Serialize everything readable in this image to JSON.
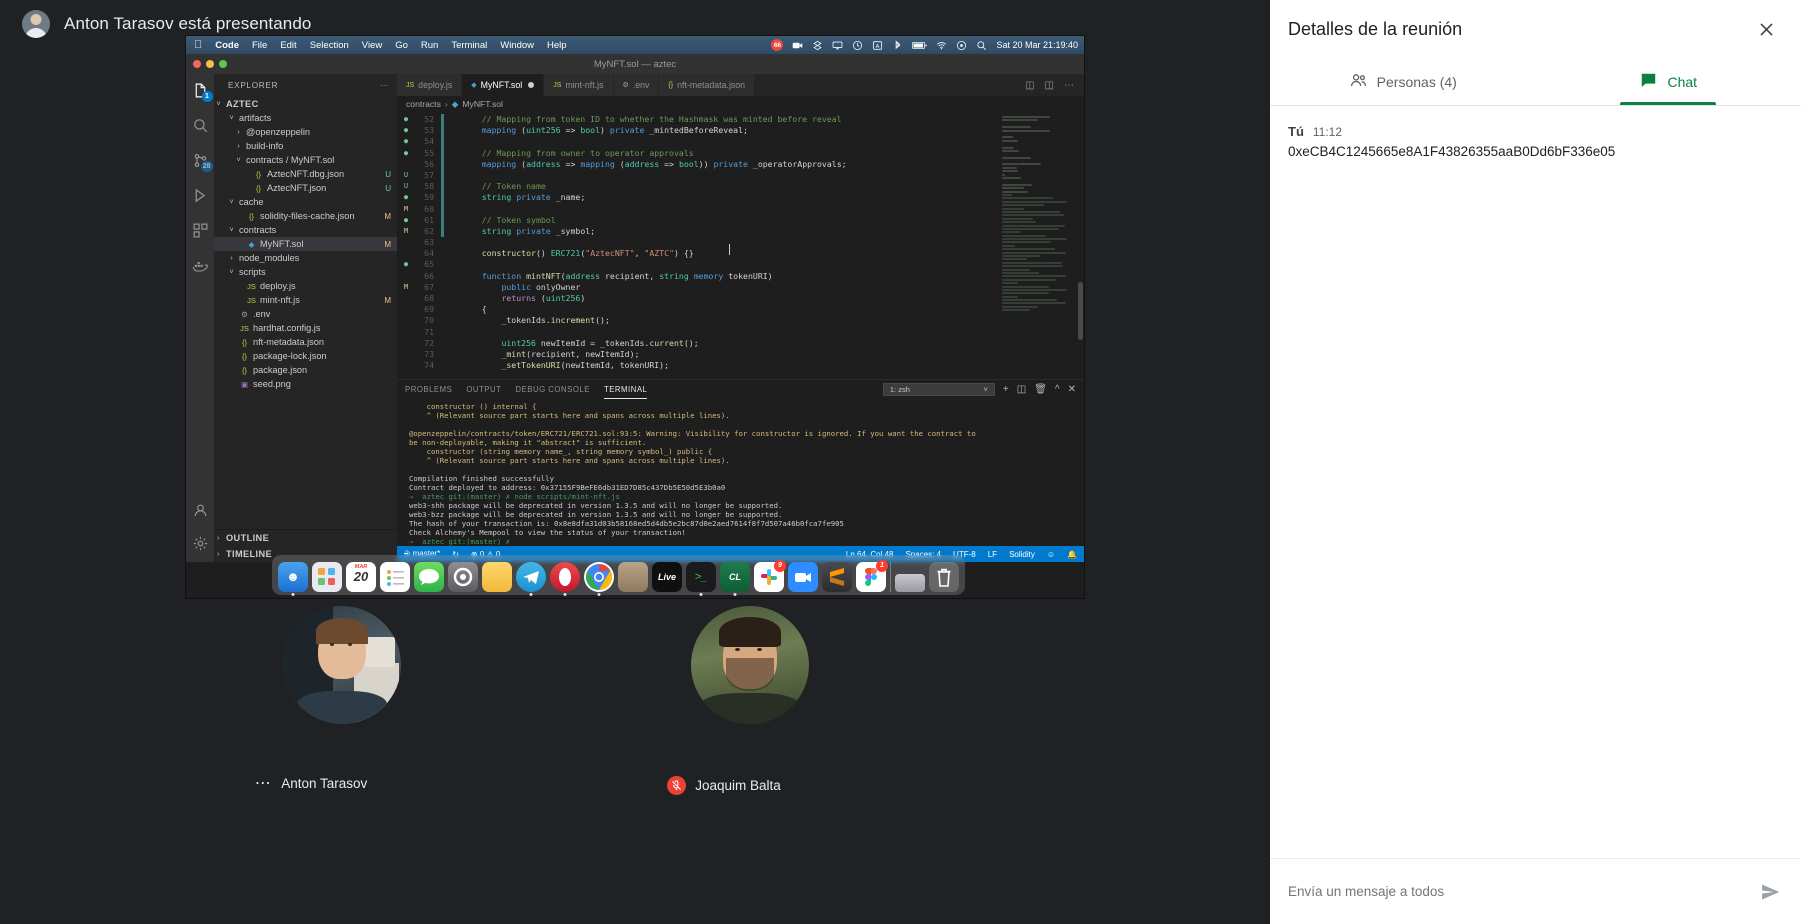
{
  "meeting": {
    "presenter_banner": "Anton Tarasov está presentando",
    "presenter_avatar": "presenter-avatar"
  },
  "details_panel": {
    "title": "Detalles de la reunión",
    "close_icon": "close-icon",
    "tabs": [
      {
        "label": "Personas (4)",
        "icon": "people-icon",
        "active": false
      },
      {
        "label": "Chat",
        "icon": "chat-icon",
        "active": true
      }
    ],
    "accent_color": "#0b8043",
    "messages": [
      {
        "author": "Tú",
        "time": "11:12",
        "text": "0xeCB4C1245665e8A1F43826355aaB0Dd6bF336e05"
      }
    ],
    "composer": {
      "placeholder": "Envía un mensaje a todos",
      "send_icon": "send-icon"
    }
  },
  "participants": [
    {
      "name": "Anton Tarasov",
      "muted": false,
      "menu_icon": "more-options-icon"
    },
    {
      "name": "Joaquim Balta",
      "muted": true,
      "mute_icon": "mic-off-icon"
    }
  ],
  "screenshare": {
    "mac_menubar": {
      "apple_icon": "apple-icon",
      "items": [
        "Code",
        "File",
        "Edit",
        "Selection",
        "View",
        "Go",
        "Run",
        "Terminal",
        "Window",
        "Help"
      ],
      "status_icons": [
        "notification-badge",
        "video-icon",
        "dropbox-icon",
        "display-icon",
        "timemachine-icon",
        "input-source-icon",
        "bluetooth-icon",
        "battery-icon",
        "wifi-icon",
        "control-center-icon",
        "search-icon"
      ],
      "badge_count": "66",
      "clock": "Sat 20 Mar  21:19:40"
    },
    "window_title": "MyNFT.sol — aztec",
    "activity_bar": [
      {
        "icon": "explorer-icon",
        "badge": "1",
        "active": true
      },
      {
        "icon": "search-icon",
        "badge": "",
        "active": false
      },
      {
        "icon": "source-control-icon",
        "badge": "28",
        "active": false
      },
      {
        "icon": "run-debug-icon",
        "badge": "",
        "active": false
      },
      {
        "icon": "extensions-icon",
        "badge": "",
        "active": false
      },
      {
        "icon": "docker-icon",
        "badge": "",
        "active": false
      },
      {
        "icon": "account-icon",
        "badge": "",
        "active": false
      },
      {
        "icon": "gear-icon",
        "badge": "",
        "active": false
      }
    ],
    "explorer": {
      "header": "EXPLORER",
      "more_icon": "ellipsis-icon",
      "root": "AZTEC",
      "items": [
        {
          "indent": 1,
          "chev": "v",
          "icon": "",
          "name": "artifacts",
          "status": "",
          "kind": "folder"
        },
        {
          "indent": 2,
          "chev": ">",
          "icon": "",
          "name": "@openzeppelin",
          "status": "",
          "kind": "folder"
        },
        {
          "indent": 2,
          "chev": ">",
          "icon": "",
          "name": "build-info",
          "status": "",
          "kind": "folder"
        },
        {
          "indent": 2,
          "chev": "v",
          "icon": "",
          "name": "contracts / MyNFT.sol",
          "status": "",
          "kind": "folder"
        },
        {
          "indent": 3,
          "chev": "",
          "icon": "{}",
          "name": "AztecNFT.dbg.json",
          "status": "U",
          "kind": "json"
        },
        {
          "indent": 3,
          "chev": "",
          "icon": "{}",
          "name": "AztecNFT.json",
          "status": "U",
          "kind": "json"
        },
        {
          "indent": 1,
          "chev": "v",
          "icon": "",
          "name": "cache",
          "status": "",
          "kind": "folder"
        },
        {
          "indent": 2,
          "chev": "",
          "icon": "{}",
          "name": "solidity-files-cache.json",
          "status": "M",
          "kind": "json"
        },
        {
          "indent": 1,
          "chev": "v",
          "icon": "",
          "name": "contracts",
          "status": "",
          "kind": "folder"
        },
        {
          "indent": 2,
          "chev": "",
          "icon": "◆",
          "name": "MyNFT.sol",
          "status": "M",
          "kind": "sol",
          "selected": true
        },
        {
          "indent": 1,
          "chev": ">",
          "icon": "",
          "name": "node_modules",
          "status": "",
          "kind": "folder"
        },
        {
          "indent": 1,
          "chev": "v",
          "icon": "",
          "name": "scripts",
          "status": "",
          "kind": "folder"
        },
        {
          "indent": 2,
          "chev": "",
          "icon": "JS",
          "name": "deploy.js",
          "status": "",
          "kind": "js"
        },
        {
          "indent": 2,
          "chev": "",
          "icon": "JS",
          "name": "mint-nft.js",
          "status": "M",
          "kind": "js"
        },
        {
          "indent": 1,
          "chev": "",
          "icon": "⚙",
          "name": ".env",
          "status": "",
          "kind": "dot"
        },
        {
          "indent": 1,
          "chev": "",
          "icon": "JS",
          "name": "hardhat.config.js",
          "status": "",
          "kind": "js"
        },
        {
          "indent": 1,
          "chev": "",
          "icon": "{}",
          "name": "nft-metadata.json",
          "status": "",
          "kind": "json"
        },
        {
          "indent": 1,
          "chev": "",
          "icon": "{}",
          "name": "package-lock.json",
          "status": "",
          "kind": "json"
        },
        {
          "indent": 1,
          "chev": "",
          "icon": "{}",
          "name": "package.json",
          "status": "",
          "kind": "json"
        },
        {
          "indent": 1,
          "chev": "",
          "icon": "▣",
          "name": "seed.png",
          "status": "",
          "kind": "png"
        }
      ],
      "sections": [
        {
          "chev": ">",
          "label": "OUTLINE"
        },
        {
          "chev": ">",
          "label": "TIMELINE"
        }
      ]
    },
    "tabs": [
      {
        "label": "deploy.js",
        "icon": "js-icon",
        "active": false,
        "dirty": false
      },
      {
        "label": "MyNFT.sol",
        "icon": "sol-icon",
        "active": true,
        "dirty": true
      },
      {
        "label": "mint-nft.js",
        "icon": "js-icon",
        "active": false,
        "dirty": false
      },
      {
        "label": ".env",
        "icon": "gear-icon",
        "active": false,
        "dirty": false
      },
      {
        "label": "nft-metadata.json",
        "icon": "json-icon",
        "active": false,
        "dirty": false
      }
    ],
    "tab_actions": [
      "split-editor-icon",
      "layout-icon",
      "more-actions-icon"
    ],
    "breadcrumb": [
      "contracts",
      "MyNFT.sol"
    ],
    "code": [
      {
        "n": "52",
        "gutter": "●",
        "bar": true,
        "tokens": [
          {
            "t": "    // Mapping from token ID to whether the Hashmask was minted before reveal",
            "c": "k-com"
          }
        ]
      },
      {
        "n": "53",
        "gutter": "●",
        "bar": true,
        "tokens": [
          {
            "t": "    ",
            "c": "k-pl"
          },
          {
            "t": "mapping",
            "c": "k-kw"
          },
          {
            "t": " (",
            "c": "k-pl"
          },
          {
            "t": "uint256",
            "c": "k-typ"
          },
          {
            "t": " => ",
            "c": "k-pl"
          },
          {
            "t": "bool",
            "c": "k-typ"
          },
          {
            "t": ") ",
            "c": "k-pl"
          },
          {
            "t": "private",
            "c": "k-kw"
          },
          {
            "t": " _mintedBeforeReveal;",
            "c": "k-pl"
          }
        ]
      },
      {
        "n": "54",
        "gutter": "●",
        "bar": true,
        "tokens": [
          {
            "t": "",
            "c": "k-pl"
          }
        ]
      },
      {
        "n": "55",
        "gutter": "●",
        "bar": true,
        "tokens": [
          {
            "t": "    // Mapping from owner to operator approvals",
            "c": "k-com"
          }
        ]
      },
      {
        "n": "56",
        "gutter": "",
        "bar": true,
        "tokens": [
          {
            "t": "    ",
            "c": "k-pl"
          },
          {
            "t": "mapping",
            "c": "k-kw"
          },
          {
            "t": " (",
            "c": "k-pl"
          },
          {
            "t": "address",
            "c": "k-typ"
          },
          {
            "t": " => ",
            "c": "k-pl"
          },
          {
            "t": "mapping",
            "c": "k-kw"
          },
          {
            "t": " (",
            "c": "k-pl"
          },
          {
            "t": "address",
            "c": "k-typ"
          },
          {
            "t": " => ",
            "c": "k-pl"
          },
          {
            "t": "bool",
            "c": "k-typ"
          },
          {
            "t": ")) ",
            "c": "k-pl"
          },
          {
            "t": "private",
            "c": "k-kw"
          },
          {
            "t": " _operatorApprovals;",
            "c": "k-pl"
          }
        ]
      },
      {
        "n": "57",
        "gutter": "U",
        "bar": true,
        "tokens": [
          {
            "t": "",
            "c": "k-pl"
          }
        ]
      },
      {
        "n": "58",
        "gutter": "U",
        "bar": true,
        "tokens": [
          {
            "t": "    // Token name",
            "c": "k-com"
          }
        ]
      },
      {
        "n": "59",
        "gutter": "●",
        "bar": true,
        "tokens": [
          {
            "t": "    ",
            "c": "k-pl"
          },
          {
            "t": "string",
            "c": "k-typ"
          },
          {
            "t": " ",
            "c": "k-pl"
          },
          {
            "t": "private",
            "c": "k-kw"
          },
          {
            "t": " _name;",
            "c": "k-pl"
          }
        ]
      },
      {
        "n": "60",
        "gutter": "M",
        "bar": true,
        "tokens": [
          {
            "t": "",
            "c": "k-pl"
          }
        ]
      },
      {
        "n": "61",
        "gutter": "●",
        "bar": true,
        "tokens": [
          {
            "t": "    // Token symbol",
            "c": "k-com"
          }
        ]
      },
      {
        "n": "62",
        "gutter": "M",
        "bar": true,
        "tokens": [
          {
            "t": "    ",
            "c": "k-pl"
          },
          {
            "t": "string",
            "c": "k-typ"
          },
          {
            "t": " ",
            "c": "k-pl"
          },
          {
            "t": "private",
            "c": "k-kw"
          },
          {
            "t": " _symbol;",
            "c": "k-pl"
          }
        ]
      },
      {
        "n": "63",
        "gutter": "",
        "bar": false,
        "tokens": [
          {
            "t": "",
            "c": "k-pl"
          }
        ]
      },
      {
        "n": "64",
        "gutter": "",
        "bar": false,
        "tokens": [
          {
            "t": "    ",
            "c": "k-pl"
          },
          {
            "t": "constructor",
            "c": "k-fn"
          },
          {
            "t": "() ",
            "c": "k-pl"
          },
          {
            "t": "ERC721",
            "c": "k-typ"
          },
          {
            "t": "(",
            "c": "k-pl"
          },
          {
            "t": "\"AztecNFT\"",
            "c": "k-str"
          },
          {
            "t": ", ",
            "c": "k-pl"
          },
          {
            "t": "\"AZTC\"",
            "c": "k-str"
          },
          {
            "t": ") {}",
            "c": "k-pl"
          }
        ]
      },
      {
        "n": "65",
        "gutter": "●",
        "bar": false,
        "tokens": [
          {
            "t": "",
            "c": "k-pl"
          }
        ]
      },
      {
        "n": "66",
        "gutter": "",
        "bar": false,
        "tokens": [
          {
            "t": "    ",
            "c": "k-pl"
          },
          {
            "t": "function",
            "c": "k-kw"
          },
          {
            "t": " ",
            "c": "k-pl"
          },
          {
            "t": "mintNFT",
            "c": "k-fn"
          },
          {
            "t": "(",
            "c": "k-pl"
          },
          {
            "t": "address",
            "c": "k-typ"
          },
          {
            "t": " recipient, ",
            "c": "k-pl"
          },
          {
            "t": "string",
            "c": "k-typ"
          },
          {
            "t": " ",
            "c": "k-pl"
          },
          {
            "t": "memory",
            "c": "k-kw"
          },
          {
            "t": " tokenURI)",
            "c": "k-pl"
          }
        ]
      },
      {
        "n": "67",
        "gutter": "M",
        "bar": false,
        "tokens": [
          {
            "t": "        ",
            "c": "k-pl"
          },
          {
            "t": "public",
            "c": "k-kw"
          },
          {
            "t": " onlyOwner",
            "c": "k-pl"
          }
        ]
      },
      {
        "n": "68",
        "gutter": "",
        "bar": false,
        "tokens": [
          {
            "t": "        ",
            "c": "k-pl"
          },
          {
            "t": "returns",
            "c": "k-ctl"
          },
          {
            "t": " (",
            "c": "k-pl"
          },
          {
            "t": "uint256",
            "c": "k-typ"
          },
          {
            "t": ")",
            "c": "k-pl"
          }
        ]
      },
      {
        "n": "69",
        "gutter": "",
        "bar": false,
        "tokens": [
          {
            "t": "    {",
            "c": "k-pl"
          }
        ]
      },
      {
        "n": "70",
        "gutter": "",
        "bar": false,
        "tokens": [
          {
            "t": "        _tokenIds.",
            "c": "k-pl"
          },
          {
            "t": "increment",
            "c": "k-fn"
          },
          {
            "t": "();",
            "c": "k-pl"
          }
        ]
      },
      {
        "n": "71",
        "gutter": "",
        "bar": false,
        "tokens": [
          {
            "t": "",
            "c": "k-pl"
          }
        ]
      },
      {
        "n": "72",
        "gutter": "",
        "bar": false,
        "tokens": [
          {
            "t": "        ",
            "c": "k-pl"
          },
          {
            "t": "uint256",
            "c": "k-typ"
          },
          {
            "t": " newItemId = _tokenIds.",
            "c": "k-pl"
          },
          {
            "t": "current",
            "c": "k-fn"
          },
          {
            "t": "();",
            "c": "k-pl"
          }
        ]
      },
      {
        "n": "73",
        "gutter": "",
        "bar": false,
        "tokens": [
          {
            "t": "        ",
            "c": "k-pl"
          },
          {
            "t": "_mint",
            "c": "k-fn"
          },
          {
            "t": "(recipient, newItemId);",
            "c": "k-pl"
          }
        ]
      },
      {
        "n": "74",
        "gutter": "",
        "bar": false,
        "tokens": [
          {
            "t": "        ",
            "c": "k-pl"
          },
          {
            "t": "_setTokenURI",
            "c": "k-fn"
          },
          {
            "t": "(newItemId, tokenURI);",
            "c": "k-pl"
          }
        ]
      }
    ],
    "panel": {
      "tabs": [
        "PROBLEMS",
        "OUTPUT",
        "DEBUG CONSOLE",
        "TERMINAL"
      ],
      "active_tab": "TERMINAL",
      "terminal_select": "1: zsh",
      "actions": [
        "new-terminal-icon",
        "split-terminal-icon",
        "kill-terminal-icon",
        "maximize-panel-icon",
        "close-panel-icon"
      ],
      "terminal_lines": [
        {
          "text": "    constructor () internal {",
          "c": "t-warn"
        },
        {
          "text": "    ^ (Relevant source part starts here and spans across multiple lines).",
          "c": "t-warn"
        },
        {
          "text": "",
          "c": "t-warn"
        },
        {
          "text": "@openzeppelin/contracts/token/ERC721/ERC721.sol:93:5: Warning: Visibility for constructor is ignored. If you want the contract to",
          "c": "t-warn"
        },
        {
          "text": "be non-deployable, making it \"abstract\" is sufficient.",
          "c": "t-warn"
        },
        {
          "text": "    constructor (string memory name_, string memory symbol_) public {",
          "c": "t-warn"
        },
        {
          "text": "    ^ (Relevant source part starts here and spans across multiple lines).",
          "c": "t-warn"
        },
        {
          "text": "",
          "c": "t-warn"
        },
        {
          "text": "Compilation finished successfully",
          "c": "t-ok"
        },
        {
          "text": "Contract deployed to address: 0x37155F9BeFE6db31ED7D85c437Db5E50d5E3b0a0",
          "c": "t-ok"
        },
        {
          "text": "→  aztec git:(master) ✗ node scripts/mint-nft.js",
          "c": "t-grn2"
        },
        {
          "text": "web3-shh package will be deprecated in version 1.3.5 and will no longer be supported.",
          "c": "t-ok"
        },
        {
          "text": "web3-bzz package will be deprecated in version 1.3.5 and will no longer be supported.",
          "c": "t-ok"
        },
        {
          "text": "The hash of your transaction is: 0x8e8dfa31d03b58168ed5d4db5e2bc87d0e2aed7614f8f7d507a46b0fca7fe905",
          "c": "t-ok"
        },
        {
          "text": "Check Alchemy's Mempool to view the status of your transaction!",
          "c": "t-ok"
        },
        {
          "text": "→  aztec git:(master) ✗ ",
          "c": "t-grn2"
        }
      ]
    },
    "statusbar": {
      "branch": "master*",
      "sync_icon": "sync-icon",
      "problems": "⊗ 0  ⚠ 0",
      "cursor": "Ln 64, Col 48",
      "spaces": "Spaces: 4",
      "encoding": "UTF-8",
      "eol": "LF",
      "language": "Solidity",
      "bell_icon": "bell-icon",
      "feedback_icon": "feedback-icon"
    },
    "dock_apps": [
      "finder",
      "launchpad",
      "calendar",
      "reminders",
      "messages",
      "settings",
      "notes",
      "telegram",
      "opera",
      "chrome",
      "files",
      "live",
      "terminal",
      "clion",
      "slack",
      "zoom",
      "sublime",
      "figma",
      "app",
      "trash"
    ],
    "dock_calendar_day": "20",
    "dock_calendar_month": "MAR"
  }
}
